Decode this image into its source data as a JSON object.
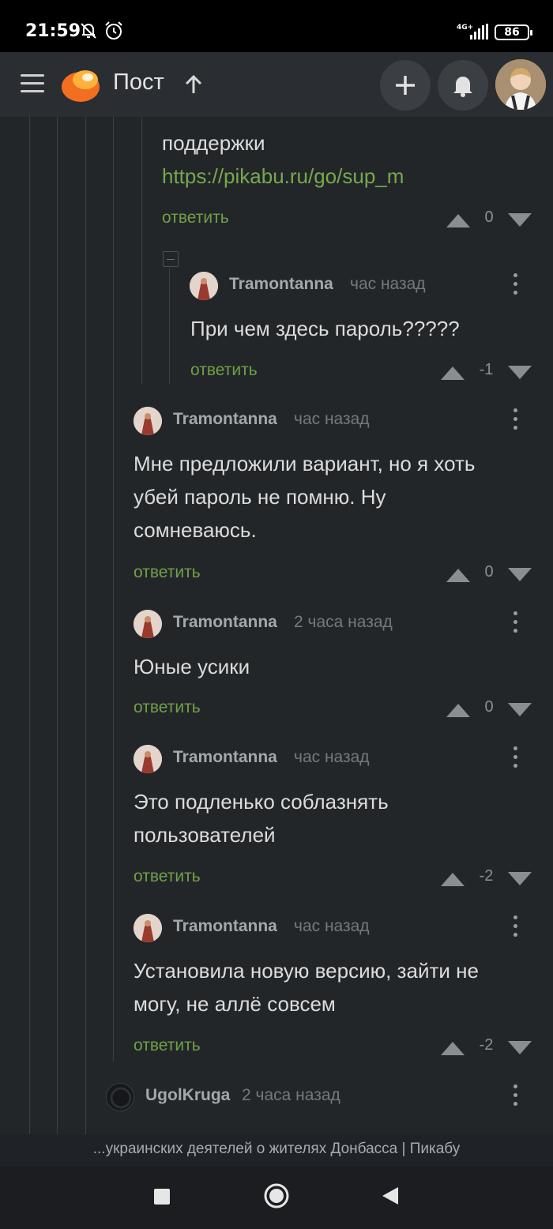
{
  "status_bar": {
    "time": "21:59",
    "network": "4G+",
    "battery": "86"
  },
  "header": {
    "title": "Пост"
  },
  "comments": {
    "prev": {
      "text_line": "поддержки",
      "link": "https://pikabu.ru/go/sup_m",
      "reply": "ответить",
      "score": "0"
    },
    "items": [
      {
        "author": "Tramontanna",
        "time": "час назад",
        "lines": [
          "При чем здесь пароль?????"
        ],
        "reply": "ответить",
        "score": "-1"
      },
      {
        "author": "Tramontanna",
        "time": "час назад",
        "lines": [
          "Мне предложили вариант, но я хоть",
          "убей пароль не помню. Ну",
          "сомневаюсь."
        ],
        "reply": "ответить",
        "score": "0"
      },
      {
        "author": "Tramontanna",
        "time": "2 часа назад",
        "lines": [
          "Юные усики"
        ],
        "reply": "ответить",
        "score": "0"
      },
      {
        "author": "Tramontanna",
        "time": "час назад",
        "lines": [
          "Это подленько соблазнять",
          "пользователей"
        ],
        "reply": "ответить",
        "score": "-2"
      },
      {
        "author": "Tramontanna",
        "time": "час назад",
        "lines": [
          "Установила новую версию, зайти не",
          "могу, не аллё совсем"
        ],
        "reply": "ответить",
        "score": "-2"
      },
      {
        "author": "UgolKruga",
        "time": "2 часа назад"
      }
    ]
  },
  "url_bar": {
    "text": "...украинских деятелей о жителях Донбасса | Пикабу"
  },
  "icons": {
    "menu": "menu-icon",
    "logo": "pikabu-logo-icon",
    "up": "arrow-up-icon",
    "add": "plus-icon",
    "bell": "bell-icon",
    "more": "more-vert-icon",
    "vote_up": "triangle-up-icon",
    "vote_down": "triangle-down-icon"
  },
  "colors": {
    "background": "#232629",
    "header": "#2a2d31",
    "link": "#76a84f",
    "reply": "#6fa048",
    "logo": "#f26f21"
  }
}
